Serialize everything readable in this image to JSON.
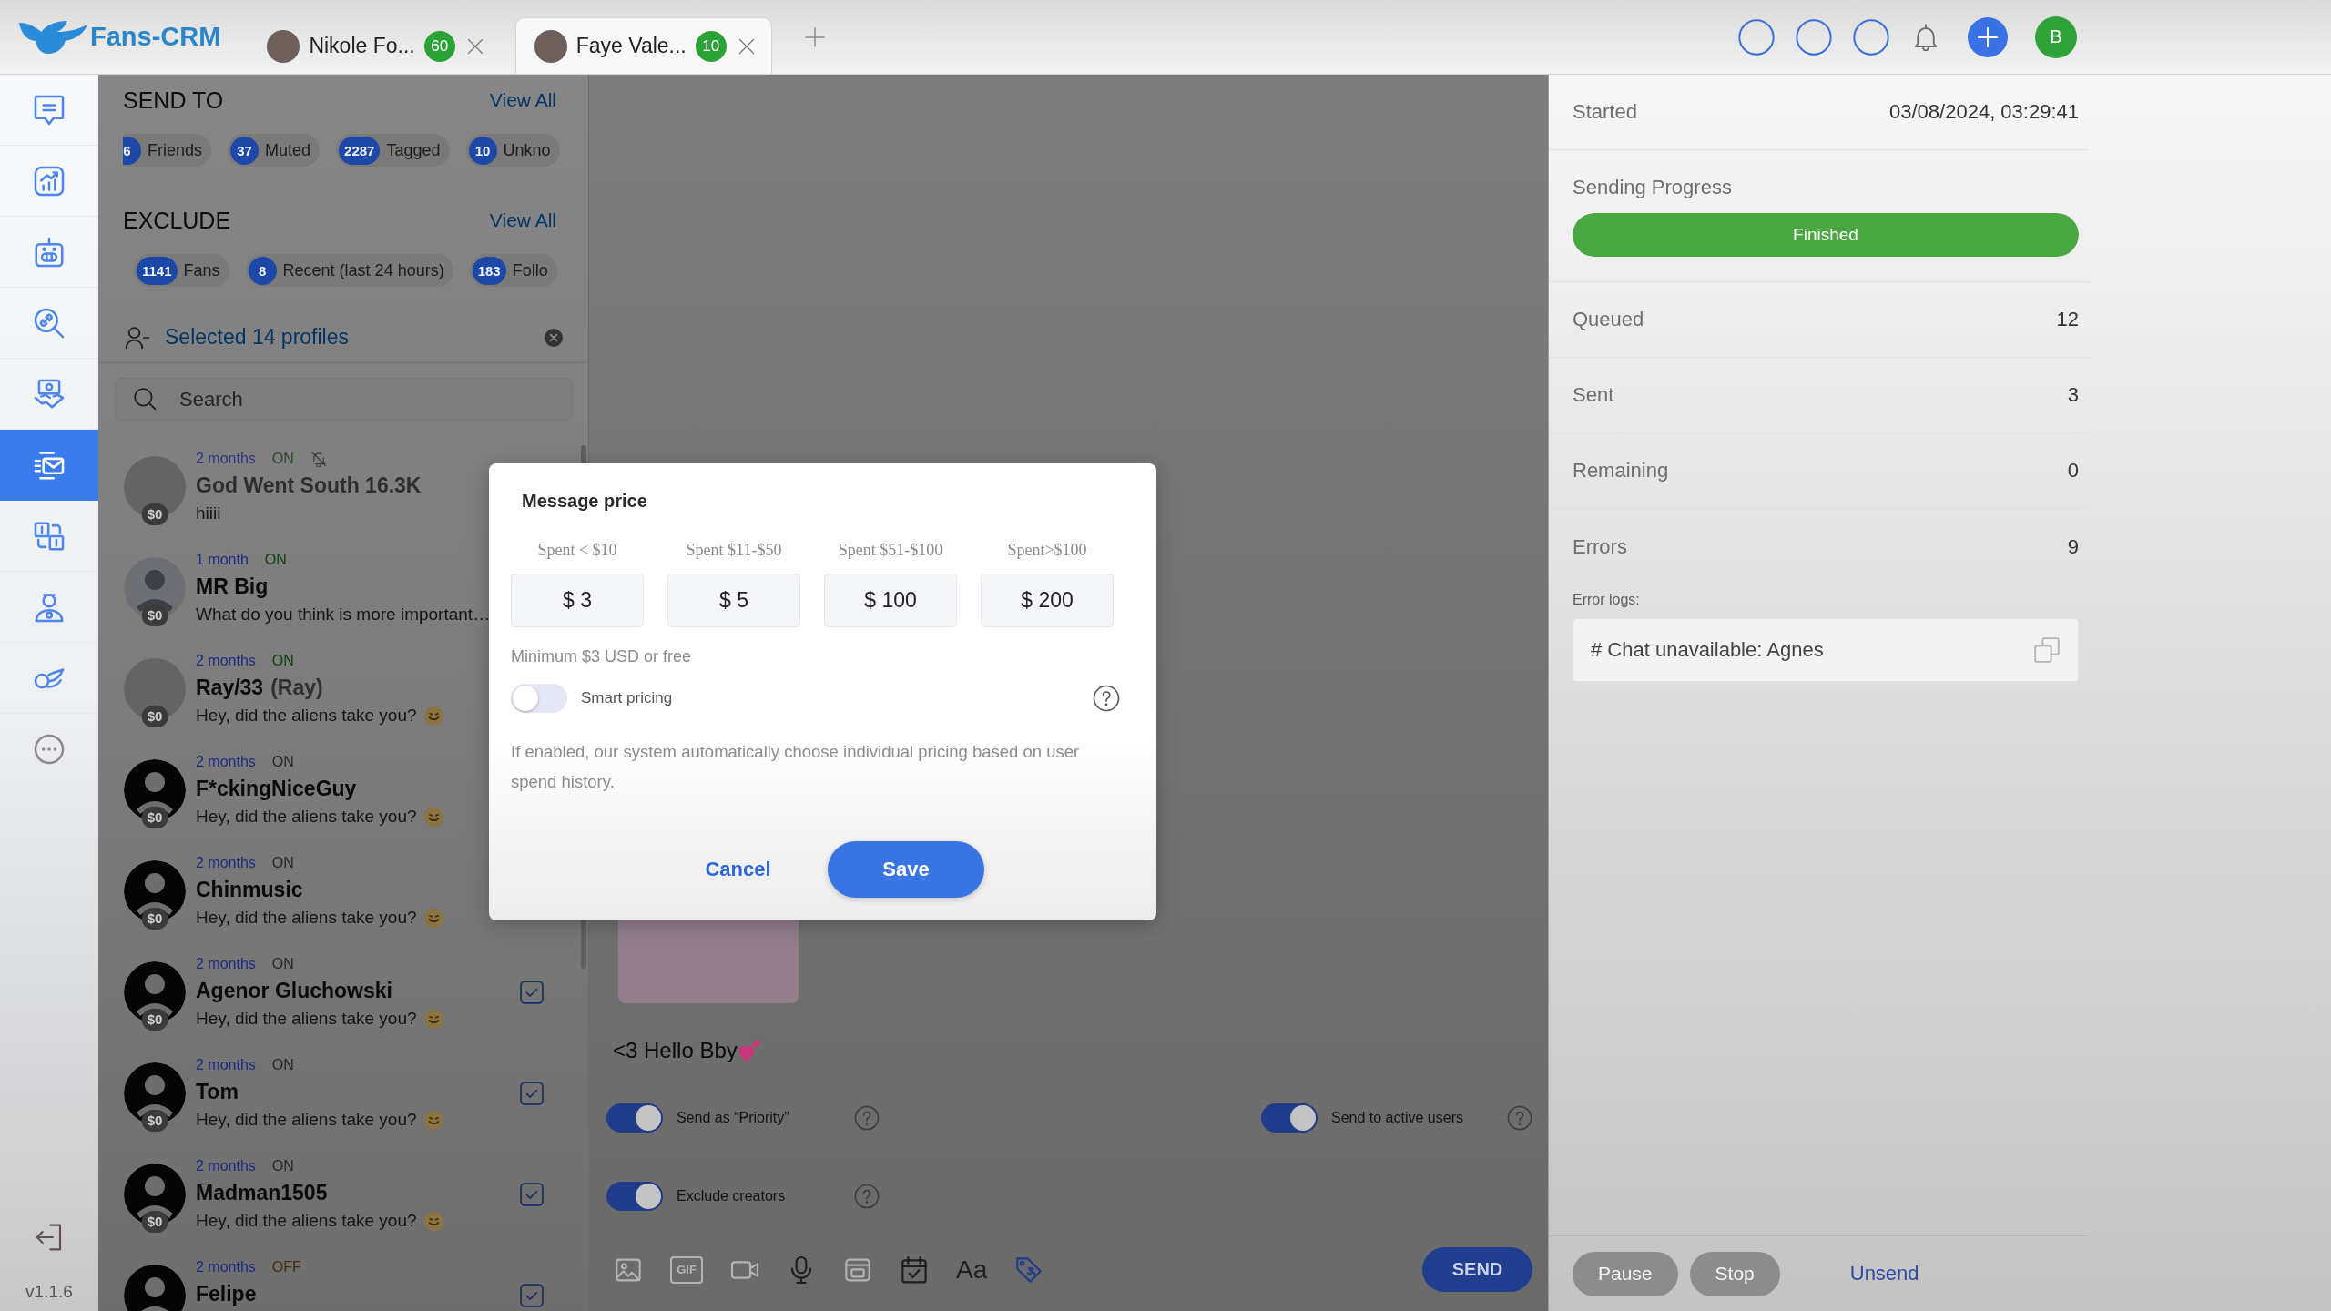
{
  "header": {
    "logo": "Fans-CRM",
    "tabs": [
      {
        "title": "Nikole Fo...",
        "badge": "60",
        "selected": false
      },
      {
        "title": "Faye Vale...",
        "badge": "10",
        "selected": true
      }
    ],
    "user_initial": "B"
  },
  "nav": {
    "items": [
      {
        "kind": "chat",
        "selected": false
      },
      {
        "kind": "stats",
        "selected": false
      },
      {
        "kind": "bot",
        "selected": false
      },
      {
        "kind": "link",
        "selected": false
      },
      {
        "kind": "deals",
        "selected": false
      },
      {
        "kind": "mass",
        "selected": true
      },
      {
        "kind": "schedule",
        "selected": false
      },
      {
        "kind": "agent",
        "selected": false
      },
      {
        "kind": "promo",
        "selected": false
      },
      {
        "kind": "more",
        "selected": false
      }
    ],
    "version": "v1.1.6"
  },
  "send_to": {
    "title": "SEND TO",
    "view_all": "View All",
    "chips": [
      {
        "count": "6",
        "label": "Friends"
      },
      {
        "count": "37",
        "label": "Muted"
      },
      {
        "count": "2287",
        "label": "Tagged"
      },
      {
        "count": "10",
        "label": "Unkno"
      }
    ]
  },
  "exclude": {
    "title": "EXCLUDE",
    "view_all": "View All",
    "chips": [
      {
        "count": "1141",
        "label": "Fans"
      },
      {
        "count": "8",
        "label": "Recent (last 24 hours)"
      },
      {
        "count": "183",
        "label": "Follo"
      }
    ]
  },
  "selection": {
    "label": "Selected 14 profiles"
  },
  "search": {
    "placeholder": "Search"
  },
  "chats": [
    {
      "avatar": {
        "kind": "photo"
      },
      "balance": "$0",
      "time": "2 months",
      "status": "ON",
      "color": "#2a4a2a",
      "muted": true,
      "name": "God Went South 16.3K",
      "preview": "hiiii",
      "emoji": false
    },
    {
      "avatar": {
        "kind": "default"
      },
      "balance": "$0",
      "time": "1 month",
      "status": "ON",
      "color": "#0c420c",
      "muted": false,
      "name": "MR Big",
      "preview": "What do you think is more important…",
      "emoji": false
    },
    {
      "avatar": {
        "kind": "photo"
      },
      "balance": "$0",
      "time": "2 months",
      "status": "ON",
      "color": "#0c420c",
      "muted": false,
      "name": "Ray/33",
      "nickname": "(Ray)",
      "preview": "Hey, did the aliens take you?",
      "emoji": true
    },
    {
      "avatar": {
        "kind": "silhouette"
      },
      "balance": "$0",
      "time": "2 months",
      "status": "ON",
      "color": "#262626",
      "muted": false,
      "name": "F*ckingNiceGuy",
      "preview": "Hey, did the aliens take you?",
      "emoji": true
    },
    {
      "avatar": {
        "kind": "silhouette"
      },
      "balance": "$0",
      "time": "2 months",
      "status": "ON",
      "color": "#262626",
      "muted": false,
      "name": "Chinmusic",
      "preview": "Hey, did the aliens take you?",
      "emoji": true
    },
    {
      "avatar": {
        "kind": "silhouette"
      },
      "balance": "$0",
      "time": "2 months",
      "status": "ON",
      "color": "#262626",
      "muted": false,
      "name": "Agenor Gluchowski",
      "preview": "Hey, did the aliens take you?",
      "emoji": true,
      "checked": true
    },
    {
      "avatar": {
        "kind": "silhouette"
      },
      "balance": "$0",
      "time": "2 months",
      "status": "ON",
      "color": "#262626",
      "muted": false,
      "name": "Tom",
      "preview": "Hey, did the aliens take you?",
      "emoji": true,
      "checked": true
    },
    {
      "avatar": {
        "kind": "silhouette"
      },
      "balance": "$0",
      "time": "2 months",
      "status": "ON",
      "color": "#262626",
      "muted": false,
      "name": "Madman1505",
      "preview": "Hey, did the aliens take you?",
      "emoji": true,
      "checked": true
    },
    {
      "avatar": {
        "kind": "silhouette"
      },
      "time": "2 months",
      "status": "OFF",
      "color": "#4a2c08",
      "muted": false,
      "name": "Felipe",
      "checked": true
    }
  ],
  "composer": {
    "message": "<3 Hello Bby",
    "options": [
      {
        "label": "Send as “Priority”",
        "on": true
      },
      {
        "label": "Send to active users",
        "on": true
      },
      {
        "label": "Exclude creators",
        "on": true
      }
    ],
    "tools": [
      {
        "kind": "image",
        "disabled": true,
        "selected": false
      },
      {
        "kind": "gif",
        "label": "GIF",
        "disabled": true,
        "selected": false
      },
      {
        "kind": "video",
        "disabled": true,
        "selected": false
      },
      {
        "kind": "mic",
        "disabled": false,
        "selected": false
      },
      {
        "kind": "gallery",
        "disabled": true,
        "selected": false
      },
      {
        "kind": "calendar",
        "disabled": false,
        "selected": false
      },
      {
        "kind": "font",
        "label": "Aa",
        "disabled": false,
        "selected": false
      },
      {
        "kind": "price",
        "disabled": false,
        "selected": true
      }
    ],
    "send": "SEND"
  },
  "price_dialog": {
    "title": "Message price",
    "tiers": [
      {
        "label": "Spent < $10",
        "price": "$ 3"
      },
      {
        "label": "Spent $11-$50",
        "price": "$ 5"
      },
      {
        "label": "Spent $51-$100",
        "price": "$ 100"
      },
      {
        "label": "Spent>$100",
        "price": "$ 200"
      }
    ],
    "note": "Minimum $3 USD or free",
    "smart_pricing": {
      "label": "Smart pricing",
      "on": false
    },
    "description": "If enabled, our system automatically choose individual pricing based on user spend history.",
    "cancel": "Cancel",
    "save": "Save"
  },
  "campaign": {
    "started": {
      "label": "Started",
      "value": "03/08/2024, 03:29:41"
    },
    "progress": {
      "label": "Sending Progress",
      "status": "Finished",
      "level": 1
    },
    "stats": [
      {
        "label": "Queued",
        "value": "12"
      },
      {
        "label": "Sent",
        "value": "3"
      },
      {
        "label": "Remaining",
        "value": "0"
      },
      {
        "label": "Errors",
        "value": "9"
      }
    ],
    "error_logs": {
      "label": "Error logs:",
      "entries": [
        "# Chat unavailable: Agnes"
      ]
    },
    "actions": [
      {
        "kind": "pill",
        "label": "Pause",
        "disabled": true
      },
      {
        "kind": "pill",
        "label": "Stop",
        "disabled": true
      },
      {
        "kind": "link",
        "label": "Unsend",
        "disabled": false
      }
    ]
  }
}
